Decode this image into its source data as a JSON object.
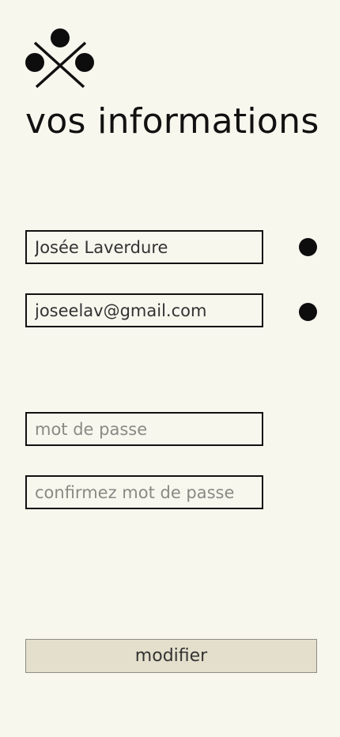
{
  "header": {
    "logo_icon": "circles-cross-logo-icon",
    "title": "vos informations"
  },
  "form": {
    "name": {
      "value": "Josée Laverdure",
      "status_icon": "filled-dot-icon"
    },
    "email": {
      "value": "joseelav@gmail.com",
      "status_icon": "filled-dot-icon"
    },
    "password": {
      "value": "",
      "placeholder": "mot de passe"
    },
    "confirm_password": {
      "value": "",
      "placeholder": "confirmez mot de passe"
    },
    "submit_label": "modifier"
  },
  "colors": {
    "background": "#f7f7ee",
    "text": "#111111",
    "button_background": "#e4dfcc",
    "placeholder": "#8a8a85"
  }
}
